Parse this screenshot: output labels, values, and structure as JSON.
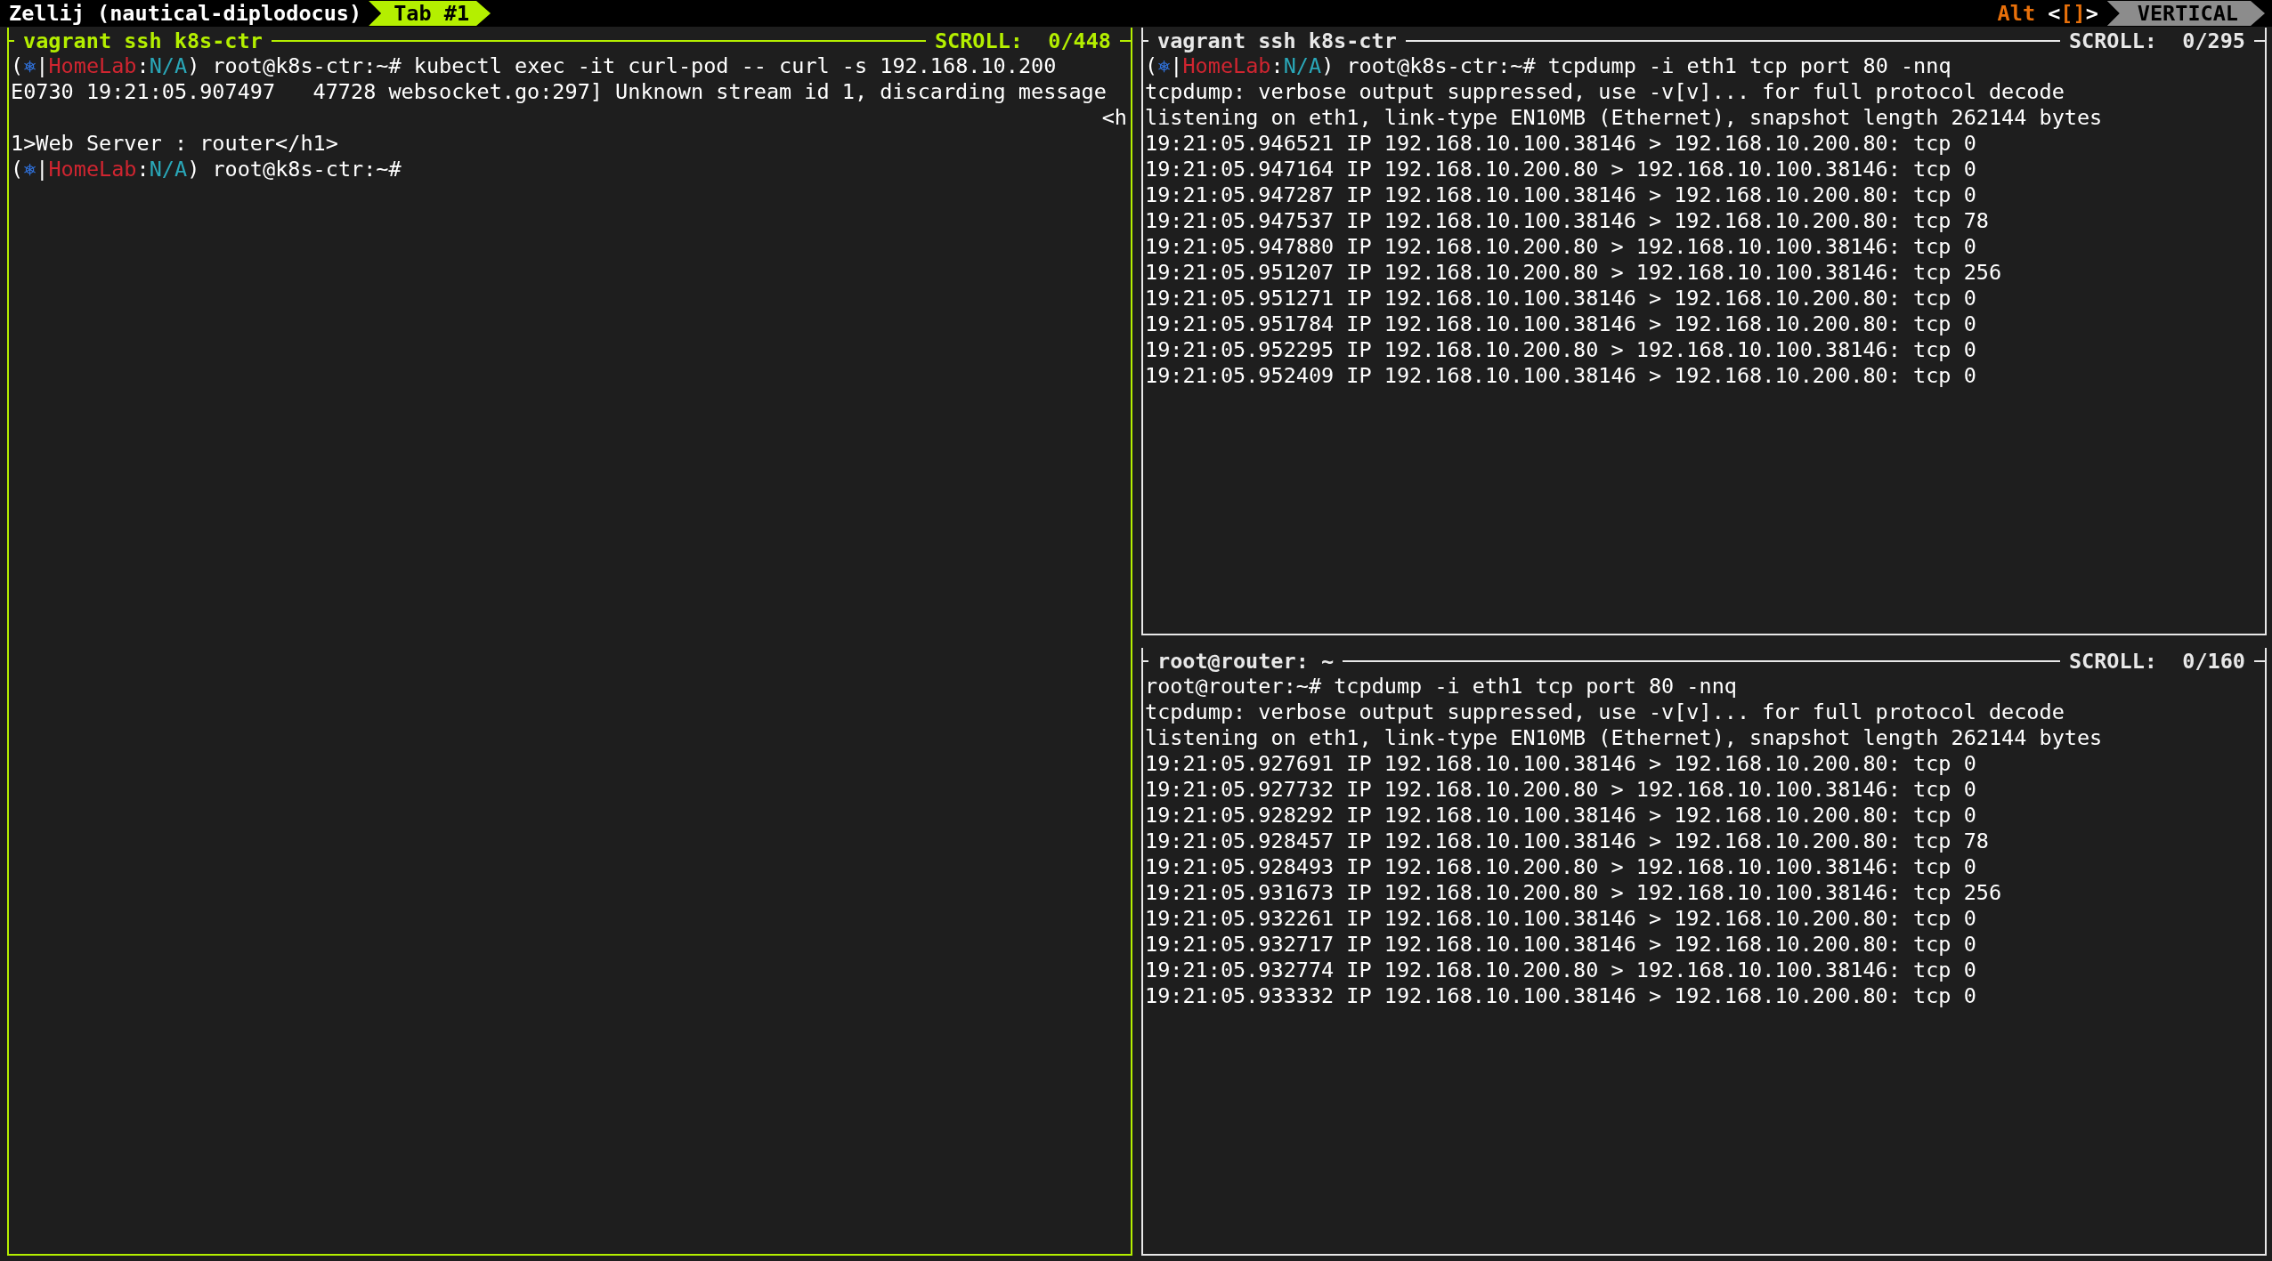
{
  "top_bar": {
    "session_title": "Zellij (nautical-diplodocus)",
    "tabs": [
      {
        "label": "Tab #1",
        "selected": true
      }
    ],
    "keybind": [
      {
        "text": "Alt",
        "color": "#e8700a"
      },
      {
        "text": " <",
        "color": "#ffffff"
      },
      {
        "text": "[]",
        "color": "#e8700a"
      },
      {
        "text": ">",
        "color": "#ffffff"
      }
    ],
    "mode": "VERTICAL"
  },
  "panes": [
    {
      "title": "vagrant ssh k8s-ctr",
      "scroll": "SCROLL:  0/448",
      "focused": true,
      "lines": [
        {
          "kind": "text",
          "segments": [
            {
              "text": "(",
              "color": "#ffffff"
            },
            {
              "text": "⎈",
              "color": "#2f6fd6"
            },
            {
              "text": "|",
              "color": "#ffffff"
            },
            {
              "text": "HomeLab",
              "color": "#d02530"
            },
            {
              "text": ":",
              "color": "#ffffff"
            },
            {
              "text": "N/A",
              "color": "#2aa7b8"
            },
            {
              "text": ") root@k8s-ctr:~# kubectl exec -it curl-pod -- curl -s 192.168.10.200",
              "color": "#ffffff"
            }
          ]
        },
        {
          "kind": "text",
          "segments": [
            {
              "text": "E0730 19:21:05.907497   47728 websocket.go:297] Unknown stream id 1, discarding message",
              "color": "#ffffff"
            }
          ]
        },
        {
          "kind": "wrapped",
          "segments": [
            {
              "text": "<h",
              "color": "#ffffff"
            }
          ]
        },
        {
          "kind": "text",
          "segments": [
            {
              "text": "1>Web Server : router</h1>",
              "color": "#ffffff"
            }
          ]
        },
        {
          "kind": "text",
          "segments": [
            {
              "text": "(",
              "color": "#ffffff"
            },
            {
              "text": "⎈",
              "color": "#2f6fd6"
            },
            {
              "text": "|",
              "color": "#ffffff"
            },
            {
              "text": "HomeLab",
              "color": "#d02530"
            },
            {
              "text": ":",
              "color": "#ffffff"
            },
            {
              "text": "N/A",
              "color": "#2aa7b8"
            },
            {
              "text": ") root@k8s-ctr:~#",
              "color": "#ffffff"
            }
          ]
        }
      ]
    },
    {
      "title": "vagrant ssh k8s-ctr",
      "scroll": "SCROLL:  0/295",
      "focused": false,
      "lines": [
        {
          "kind": "text",
          "segments": [
            {
              "text": "(",
              "color": "#ffffff"
            },
            {
              "text": "⎈",
              "color": "#2f6fd6"
            },
            {
              "text": "|",
              "color": "#ffffff"
            },
            {
              "text": "HomeLab",
              "color": "#d02530"
            },
            {
              "text": ":",
              "color": "#ffffff"
            },
            {
              "text": "N/A",
              "color": "#2aa7b8"
            },
            {
              "text": ") root@k8s-ctr:~# tcpdump -i eth1 tcp port 80 -nnq",
              "color": "#ffffff"
            }
          ]
        },
        {
          "kind": "text",
          "segments": [
            {
              "text": "tcpdump: verbose output suppressed, use -v[v]... for full protocol decode",
              "color": "#ffffff"
            }
          ]
        },
        {
          "kind": "text",
          "segments": [
            {
              "text": "listening on eth1, link-type EN10MB (Ethernet), snapshot length 262144 bytes",
              "color": "#ffffff"
            }
          ]
        },
        {
          "kind": "text",
          "segments": [
            {
              "text": "19:21:05.946521 IP 192.168.10.100.38146 > 192.168.10.200.80: tcp 0",
              "color": "#ffffff"
            }
          ]
        },
        {
          "kind": "text",
          "segments": [
            {
              "text": "19:21:05.947164 IP 192.168.10.200.80 > 192.168.10.100.38146: tcp 0",
              "color": "#ffffff"
            }
          ]
        },
        {
          "kind": "text",
          "segments": [
            {
              "text": "19:21:05.947287 IP 192.168.10.100.38146 > 192.168.10.200.80: tcp 0",
              "color": "#ffffff"
            }
          ]
        },
        {
          "kind": "text",
          "segments": [
            {
              "text": "19:21:05.947537 IP 192.168.10.100.38146 > 192.168.10.200.80: tcp 78",
              "color": "#ffffff"
            }
          ]
        },
        {
          "kind": "text",
          "segments": [
            {
              "text": "19:21:05.947880 IP 192.168.10.200.80 > 192.168.10.100.38146: tcp 0",
              "color": "#ffffff"
            }
          ]
        },
        {
          "kind": "text",
          "segments": [
            {
              "text": "19:21:05.951207 IP 192.168.10.200.80 > 192.168.10.100.38146: tcp 256",
              "color": "#ffffff"
            }
          ]
        },
        {
          "kind": "text",
          "segments": [
            {
              "text": "19:21:05.951271 IP 192.168.10.100.38146 > 192.168.10.200.80: tcp 0",
              "color": "#ffffff"
            }
          ]
        },
        {
          "kind": "text",
          "segments": [
            {
              "text": "19:21:05.951784 IP 192.168.10.100.38146 > 192.168.10.200.80: tcp 0",
              "color": "#ffffff"
            }
          ]
        },
        {
          "kind": "text",
          "segments": [
            {
              "text": "19:21:05.952295 IP 192.168.10.200.80 > 192.168.10.100.38146: tcp 0",
              "color": "#ffffff"
            }
          ]
        },
        {
          "kind": "text",
          "segments": [
            {
              "text": "19:21:05.952409 IP 192.168.10.100.38146 > 192.168.10.200.80: tcp 0",
              "color": "#ffffff"
            }
          ]
        }
      ]
    },
    {
      "title": "root@router: ~",
      "scroll": "SCROLL:  0/160",
      "focused": false,
      "lines": [
        {
          "kind": "text",
          "segments": [
            {
              "text": "root@router:~# tcpdump -i eth1 tcp port 80 -nnq",
              "color": "#ffffff"
            }
          ]
        },
        {
          "kind": "text",
          "segments": [
            {
              "text": "tcpdump: verbose output suppressed, use -v[v]... for full protocol decode",
              "color": "#ffffff"
            }
          ]
        },
        {
          "kind": "text",
          "segments": [
            {
              "text": "listening on eth1, link-type EN10MB (Ethernet), snapshot length 262144 bytes",
              "color": "#ffffff"
            }
          ]
        },
        {
          "kind": "text",
          "segments": [
            {
              "text": "19:21:05.927691 IP 192.168.10.100.38146 > 192.168.10.200.80: tcp 0",
              "color": "#ffffff"
            }
          ]
        },
        {
          "kind": "text",
          "segments": [
            {
              "text": "19:21:05.927732 IP 192.168.10.200.80 > 192.168.10.100.38146: tcp 0",
              "color": "#ffffff"
            }
          ]
        },
        {
          "kind": "text",
          "segments": [
            {
              "text": "19:21:05.928292 IP 192.168.10.100.38146 > 192.168.10.200.80: tcp 0",
              "color": "#ffffff"
            }
          ]
        },
        {
          "kind": "text",
          "segments": [
            {
              "text": "19:21:05.928457 IP 192.168.10.100.38146 > 192.168.10.200.80: tcp 78",
              "color": "#ffffff"
            }
          ]
        },
        {
          "kind": "text",
          "segments": [
            {
              "text": "19:21:05.928493 IP 192.168.10.200.80 > 192.168.10.100.38146: tcp 0",
              "color": "#ffffff"
            }
          ]
        },
        {
          "kind": "text",
          "segments": [
            {
              "text": "19:21:05.931673 IP 192.168.10.200.80 > 192.168.10.100.38146: tcp 256",
              "color": "#ffffff"
            }
          ]
        },
        {
          "kind": "text",
          "segments": [
            {
              "text": "19:21:05.932261 IP 192.168.10.100.38146 > 192.168.10.200.80: tcp 0",
              "color": "#ffffff"
            }
          ]
        },
        {
          "kind": "text",
          "segments": [
            {
              "text": "19:21:05.932717 IP 192.168.10.100.38146 > 192.168.10.200.80: tcp 0",
              "color": "#ffffff"
            }
          ]
        },
        {
          "kind": "text",
          "segments": [
            {
              "text": "19:21:05.932774 IP 192.168.10.200.80 > 192.168.10.100.38146: tcp 0",
              "color": "#ffffff"
            }
          ]
        },
        {
          "kind": "text",
          "segments": [
            {
              "text": "19:21:05.933332 IP 192.168.10.100.38146 > 192.168.10.200.80: tcp 0",
              "color": "#ffffff"
            }
          ]
        }
      ]
    }
  ]
}
